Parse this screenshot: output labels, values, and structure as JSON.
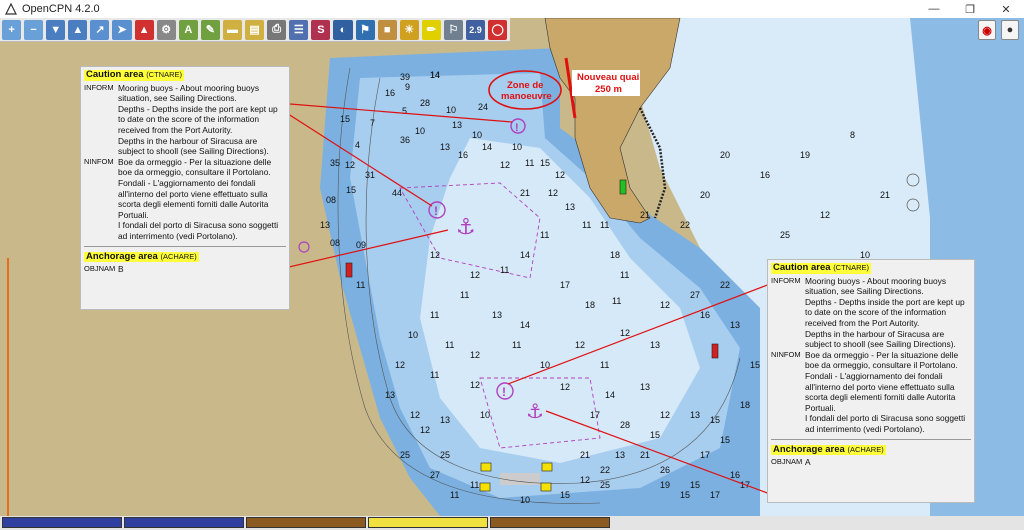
{
  "app": {
    "title": "OpenCPN 4.2.0"
  },
  "toolbar": {
    "zoom_in": "Zoom in",
    "zoom_out": "Zoom out",
    "scale_in": "Scale in",
    "scale_out": "Scale out",
    "route": "Route",
    "auto_follow": "Auto follow",
    "settings": "Settings",
    "text": "Text",
    "current": "Current",
    "tide": "Tide",
    "print": "Print",
    "route_manager": "Route manager",
    "track": "Track",
    "color_scheme": "Color scheme",
    "mob": "MOB",
    "quilt_value": "2.9",
    "dashboard": "Dashboard",
    "grib": "Grib",
    "ais": "AIS"
  },
  "map_labels": {
    "zone": "Zone de manoeuvre",
    "quai_line1": "Nouveau quai",
    "quai_line2": "250 m"
  },
  "soundings": [
    "39",
    "14",
    "16",
    "9",
    "28",
    "5",
    "15",
    "7",
    "10",
    "36",
    "4",
    "35",
    "31",
    "44",
    "12",
    "08",
    "15",
    "13",
    "09",
    "08",
    "11",
    "14",
    "10",
    "24",
    "13",
    "10",
    "13",
    "16",
    "14",
    "12",
    "10",
    "11",
    "15",
    "12",
    "13",
    "21",
    "12",
    "11",
    "11",
    "11",
    "12",
    "12",
    "11",
    "14",
    "11",
    "13",
    "14",
    "17",
    "18",
    "18",
    "11",
    "11",
    "11",
    "11",
    "12",
    "11",
    "10",
    "12",
    "12",
    "13",
    "11",
    "12",
    "12",
    "11",
    "10",
    "12",
    "13",
    "12",
    "13",
    "10",
    "17",
    "28",
    "15",
    "14",
    "13",
    "12",
    "13",
    "17",
    "15",
    "16",
    "15",
    "19",
    "13",
    "22",
    "21",
    "12",
    "25",
    "27",
    "11",
    "11",
    "25",
    "10",
    "15",
    "12",
    "25",
    "21",
    "26",
    "15",
    "17",
    "17",
    "15",
    "18",
    "15",
    "13",
    "16",
    "27",
    "22",
    "12",
    "21",
    "22",
    "20",
    "20",
    "16",
    "19",
    "8",
    "21",
    "12",
    "25",
    "10",
    "19",
    "26",
    "8"
  ],
  "popup_left": {
    "caution_title": "Caution area",
    "caution_code": "(CTNARE)",
    "inform_key": "INFORM",
    "inform_lines": [
      "Mooring buoys - About mooring buoys",
      "situation, see Sailing Directions.",
      "Depths - Depths inside the port are kept up",
      "to date on the score of the information",
      "received from the Port Autority.",
      "Depths in the harbour of Siracusa are",
      "subject to shooll (see Sailing Directions)."
    ],
    "ninfom_key": "NINFOM",
    "ninfom_lines": [
      "Boe da ormeggio - Per la situazione delle",
      "boe da ormeggio, consultare il Portolano.",
      "Fondali - L'aggiornamento dei fondali",
      "all'interno del porto viene effettuato sulla",
      "scorta degli elementi forniti dalle Autorita",
      "Portuali.",
      "I fondali del porto di Siracusa sono soggetti",
      "ad interrimento (vedi Portolano)."
    ],
    "anchor_title": "Anchorage area",
    "anchor_code": "(ACHARE)",
    "objnam_key": "OBJNAM",
    "objnam_value": "B"
  },
  "popup_right": {
    "caution_title": "Caution area",
    "caution_code": "(CTNARE)",
    "inform_key": "INFORM",
    "inform_lines": [
      "Mooring buoys - About mooring buoys",
      "situation, see Sailing Directions.",
      "Depths - Depths inside the port are kept up",
      "to date on the score of the information",
      "received from the Port Autority.",
      "Depths in the harbour of Siracusa are",
      "subject to shooll (see Sailing Directions)."
    ],
    "ninfom_key": "NINFOM",
    "ninfom_lines": [
      "Boe da ormeggio - Per la situazione delle",
      "boe da ormeggio, consultare il Portolano.",
      "Fondali - L'aggiornamento dei fondali",
      "all'interno del porto viene effettuato sulla",
      "scorta degli elementi forniti dalle Autorita",
      "Portuali.",
      "I fondali del porto di Siracusa sono soggetti",
      "ad interrimento (vedi Portolano)."
    ],
    "anchor_title": "Anchorage area",
    "anchor_code": "(ACHARE)",
    "objnam_key": "OBJNAM",
    "objnam_value": "A"
  },
  "colors": {
    "land": "#c9b98a",
    "deep": "#7bb0e0",
    "mid": "#a7cdef",
    "shallow": "#d6e9f8",
    "annotation": "#e01010",
    "caution": "#b040c0"
  }
}
